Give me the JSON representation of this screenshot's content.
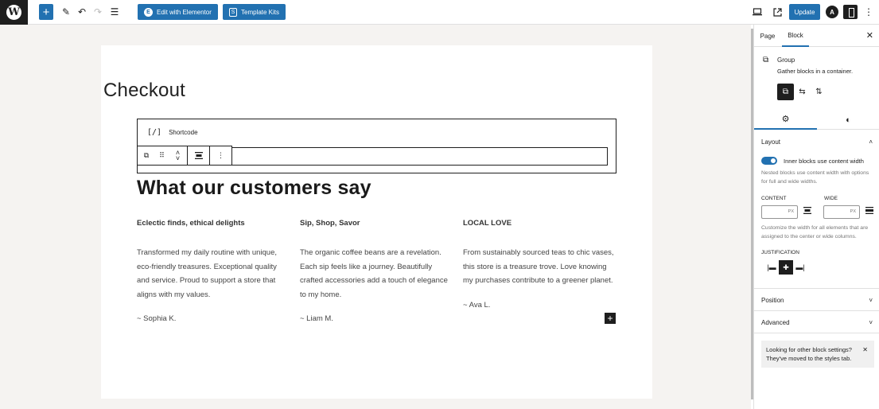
{
  "toolbar": {
    "logo": "W",
    "plus": "+",
    "edit_with_elementor": "Edit with Elementor",
    "elementor_badge": "E",
    "template_kits": "Template Kits",
    "template_kits_badge": "S",
    "update": "Update",
    "astra_badge": "A",
    "icons": [
      "wordpress-logo-icon",
      "plus-icon",
      "pencil-icon",
      "undo-icon",
      "redo-icon",
      "list-view-icon",
      "desktop-preview-icon",
      "external-link-icon",
      "astra-icon",
      "sidebar-icon",
      "more-vertical-icon"
    ]
  },
  "page": {
    "title": "Checkout",
    "shortcode_label": "Shortcode",
    "shortcode_icon": "[/]",
    "section_title": "What our customers say",
    "testimonials": [
      {
        "title": "Eclectic finds, ethical delights",
        "body": "Transformed my daily routine with unique, eco-friendly treasures. Exceptional quality and service. Proud to support a store that aligns with my values.",
        "author": "~ Sophia K."
      },
      {
        "title": "Sip, Shop, Savor",
        "body": "The organic coffee beans are a revelation. Each sip feels like a journey. Beautifully crafted accessories add a touch of elegance to my home.",
        "author": "~ Liam M."
      },
      {
        "title": "LOCAL LOVE",
        "body": "From sustainably sourced teas to chic vases, this store is a treasure trove. Love knowing my purchases contribute to a greener planet.",
        "author": "~ Ava L."
      }
    ],
    "add_block": "+"
  },
  "sidebar": {
    "tabs": {
      "page": "Page",
      "block": "Block"
    },
    "close": "✕",
    "block_card": {
      "title": "Group",
      "description": "Gather blocks in a container."
    },
    "layout": {
      "heading": "Layout",
      "toggle_label": "Inner blocks use content width",
      "toggle_on": true,
      "help_nested": "Nested blocks use content width with options for full and wide widths.",
      "content_label": "CONTENT",
      "wide_label": "WIDE",
      "content_unit": "PX",
      "wide_unit": "PX",
      "help_customize": "Customize the width for all elements that are assigned to the center or wide columns.",
      "justification_label": "JUSTIFICATION",
      "justification_selected": "center"
    },
    "position": "Position",
    "advanced": "Advanced",
    "notice": "Looking for other block settings? They've moved to the styles tab.",
    "notice_close": "✕"
  },
  "colors": {
    "accent": "#2271b1",
    "dark": "#1e1e1e",
    "canvas_bg": "#f5f3f1"
  }
}
